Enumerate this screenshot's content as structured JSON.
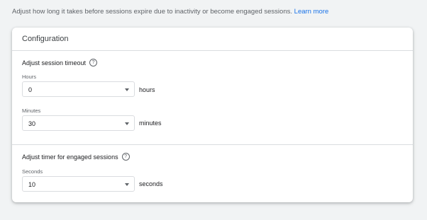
{
  "intro": {
    "text": "Adjust how long it takes before sessions expire due to inactivity or become engaged sessions.",
    "link": "Learn more"
  },
  "card": {
    "title": "Configuration"
  },
  "session_timeout": {
    "title": "Adjust session timeout",
    "help_icon": "help-circle-icon",
    "hours": {
      "label": "Hours",
      "value": "0",
      "unit": "hours"
    },
    "minutes": {
      "label": "Minutes",
      "value": "30",
      "unit": "minutes"
    }
  },
  "engaged_sessions": {
    "title": "Adjust timer for engaged sessions",
    "help_icon": "help-circle-icon",
    "seconds": {
      "label": "Seconds",
      "value": "10",
      "unit": "seconds"
    }
  },
  "colors": {
    "link": "#1a73e8",
    "background": "#f1f3f4",
    "card": "#ffffff",
    "border": "#dadce0"
  }
}
